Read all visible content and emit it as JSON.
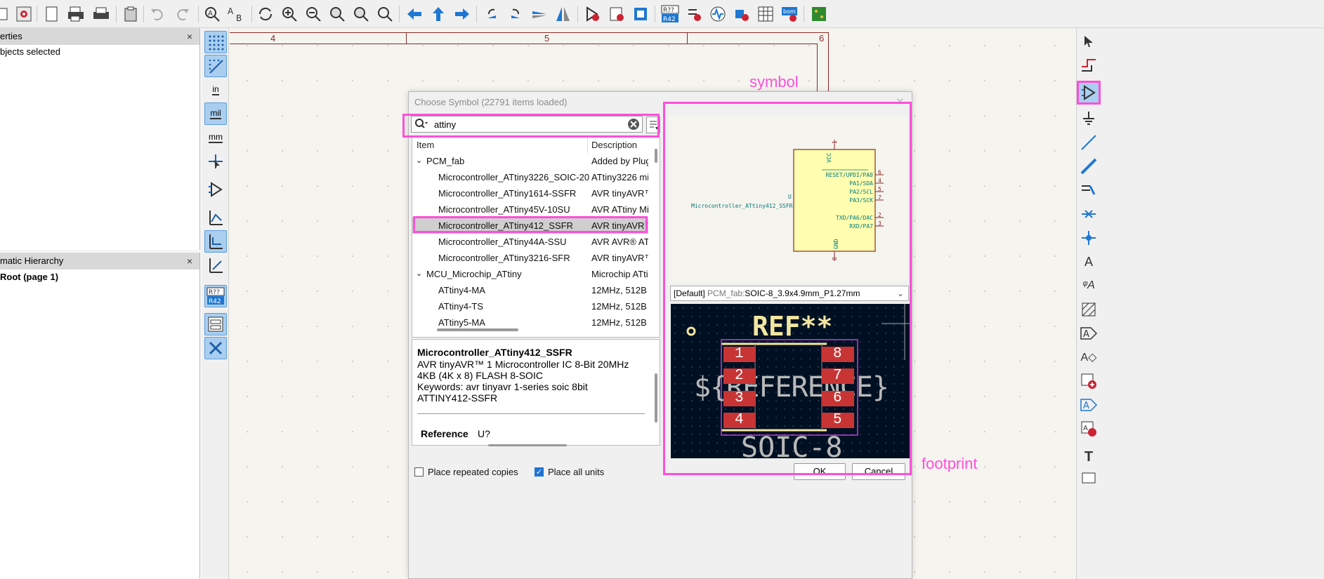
{
  "properties_panel": {
    "title": "erties",
    "status": "bjects selected",
    "close": "×"
  },
  "hierarchy_panel": {
    "title": "matic Hierarchy",
    "root": "Root (page 1)",
    "close": "×"
  },
  "left_toolbar": {
    "unit_in": "in",
    "unit_mil": "mil",
    "unit_mm": "mm",
    "annotate_top": "R??",
    "annotate_bottom": "R42"
  },
  "sheet_frame": {
    "col4": "4",
    "col5": "5",
    "col6": "6"
  },
  "dialog": {
    "title": "Choose Symbol (22791 items loaded)",
    "search_value": "attiny",
    "columns": {
      "item": "Item",
      "description": "Description"
    },
    "rows": [
      {
        "name": "PCM_fab",
        "desc": "Added by Plugi",
        "level": 0
      },
      {
        "name": "Microcontroller_ATtiny3226_SOIC-20",
        "desc": "ATtiny3226 mic",
        "level": 1
      },
      {
        "name": "Microcontroller_ATtiny1614-SSFR",
        "desc": "AVR tinyAVR™ 1",
        "level": 1
      },
      {
        "name": "Microcontroller_ATtiny45V-10SU",
        "desc": "AVR ATtiny Mic",
        "level": 1
      },
      {
        "name": "Microcontroller_ATtiny412_SSFR",
        "desc": "AVR tinyAVR™ 1",
        "level": 1
      },
      {
        "name": "Microcontroller_ATtiny44A-SSU",
        "desc": "AVR AVR® ATti",
        "level": 1
      },
      {
        "name": "Microcontroller_ATtiny3216-SFR",
        "desc": "AVR tinyAVR™ 1",
        "level": 1
      },
      {
        "name": "MCU_Microchip_ATtiny",
        "desc": "Microchip ATtin",
        "level": 0
      },
      {
        "name": "ATtiny4-MA",
        "desc": "12MHz, 512B Fl",
        "level": 1
      },
      {
        "name": "ATtiny4-TS",
        "desc": "12MHz, 512B Fl",
        "level": 1
      },
      {
        "name": "ATtiny5-MA",
        "desc": "12MHz, 512B Fl",
        "level": 1
      }
    ],
    "details": {
      "name": "Microcontroller_ATtiny412_SSFR",
      "line1": "AVR tinyAVR™ 1 Microcontroller IC 8-Bit 20MHz",
      "line2": "4KB (4K x 8) FLASH 8-SOIC",
      "line3": "Keywords: avr tinyavr 1-series soic 8bit",
      "line4": "ATTINY412-SSFR",
      "ref_label": "Reference",
      "ref_value": "U?"
    },
    "place_repeated": "Place repeated copies",
    "place_all_units": "Place all units",
    "ok": "OK",
    "cancel": "Cancel",
    "footprint_select": {
      "prefix": "[Default]",
      "lib": "PCM_fab:",
      "name": "SOIC-8_3.9x4.9mm_P1.27mm"
    }
  },
  "symbol": {
    "ref": "U",
    "value": "Microcontroller_ATtiny412_SSFR",
    "pin_vcc": "VCC",
    "pin_gnd": "GND",
    "pin_vcc_num": "1",
    "pin_gnd_num": "8",
    "right_pins": [
      {
        "label": "RESET/UPDI/PA0",
        "num": "6"
      },
      {
        "label": "PA1/SDA",
        "num": "4"
      },
      {
        "label": "PA2/SCL",
        "num": "5"
      },
      {
        "label": "PA3/SCK",
        "num": "7"
      },
      {
        "label": "TXD/PA6/DAC",
        "num": "2"
      },
      {
        "label": "RXD/PA7",
        "num": "3"
      }
    ]
  },
  "footprint": {
    "ref_text": "REF**",
    "reference_text": "${REFERENCE}",
    "value_text": "SOIC-8",
    "pads_left": [
      "1",
      "2",
      "3",
      "4"
    ],
    "pads_right": [
      "8",
      "7",
      "6",
      "5"
    ]
  },
  "annotations": {
    "symbol": "symbol",
    "footprint": "footprint"
  },
  "colors": {
    "highlight": "#ff4fd8",
    "pad": "#c83434",
    "silk": "#f2e6a0",
    "sheet_frame": "#8a2929"
  }
}
